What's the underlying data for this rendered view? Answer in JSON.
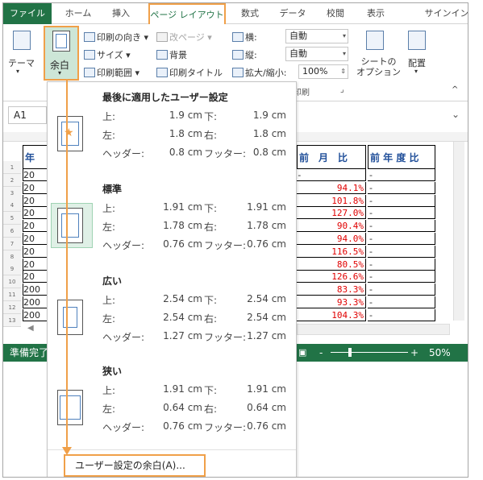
{
  "tabs": {
    "file": "ファイル",
    "home": "ホーム",
    "insert": "挿入",
    "page_layout": "ページ レイアウト",
    "formulas": "数式",
    "data": "データ",
    "review": "校閲",
    "view": "表示",
    "signin": "サインイン"
  },
  "ribbon": {
    "theme": "テーマ",
    "margins": "余白",
    "orientation": "印刷の向き",
    "breaks": "改ページ",
    "size": "サイズ",
    "background": "背景",
    "print_area": "印刷範囲",
    "print_titles": "印刷タイトル",
    "width_label": "横:",
    "width_value": "自動",
    "height_label": "縦:",
    "height_value": "自動",
    "scale_label": "拡大/縮小:",
    "scale_value": "100%",
    "sheet_options": "シートの\nオプション",
    "arrange": "配置",
    "group_print": "印刷"
  },
  "name_box": "A1",
  "sheet": {
    "header_left": "年",
    "header_mid": "前　月　比",
    "header_right": "前 年 度 比",
    "row_numbers": [
      "1",
      "2",
      "3",
      "4",
      "5",
      "6",
      "7",
      "8",
      "9",
      "10",
      "11",
      "12",
      "13"
    ],
    "left_cells": [
      "20",
      "20",
      "20",
      "20",
      "20",
      "20",
      "20",
      "20",
      "20",
      "200",
      "200",
      "200"
    ],
    "pct_values": [
      "",
      "94.1%",
      "101.8%",
      "127.0%",
      "90.4%",
      "94.0%",
      "116.5%",
      "80.5%",
      "126.6%",
      "83.3%",
      "93.3%",
      "104.3%"
    ],
    "dash_first_pct": "-",
    "dash": "-"
  },
  "status": {
    "ready": "準備完了",
    "zoom": "50%",
    "zoom_out": "-",
    "zoom_in": "+"
  },
  "margins_dropdown": {
    "presets": [
      {
        "title": "最後に適用したユーザー設定",
        "top_label": "上:",
        "top": "1.9 cm",
        "bottom_label": "下:",
        "bottom": "1.9 cm",
        "left_label": "左:",
        "left": "1.8 cm",
        "right_label": "右:",
        "right": "1.8 cm",
        "header_label": "ヘッダー:",
        "header": "0.8 cm",
        "footer_label": "フッター:",
        "footer": "0.8 cm"
      },
      {
        "title": "標準",
        "top_label": "上:",
        "top": "1.91 cm",
        "bottom_label": "下:",
        "bottom": "1.91 cm",
        "left_label": "左:",
        "left": "1.78 cm",
        "right_label": "右:",
        "right": "1.78 cm",
        "header_label": "ヘッダー:",
        "header": "0.76 cm",
        "footer_label": "フッター:",
        "footer": "0.76 cm"
      },
      {
        "title": "広い",
        "top_label": "上:",
        "top": "2.54 cm",
        "bottom_label": "下:",
        "bottom": "2.54 cm",
        "left_label": "左:",
        "left": "2.54 cm",
        "right_label": "右:",
        "right": "2.54 cm",
        "header_label": "ヘッダー:",
        "header": "1.27 cm",
        "footer_label": "フッター:",
        "footer": "1.27 cm"
      },
      {
        "title": "狭い",
        "top_label": "上:",
        "top": "1.91 cm",
        "bottom_label": "下:",
        "bottom": "1.91 cm",
        "left_label": "左:",
        "left": "0.64 cm",
        "right_label": "右:",
        "right": "0.64 cm",
        "header_label": "ヘッダー:",
        "header": "0.76 cm",
        "footer_label": "フッター:",
        "footer": "0.76 cm"
      }
    ],
    "custom": "ユーザー設定の余白(A)..."
  },
  "colors": {
    "excel_green": "#217346",
    "highlight_orange": "#f0a049",
    "pct_red": "#e00000"
  }
}
